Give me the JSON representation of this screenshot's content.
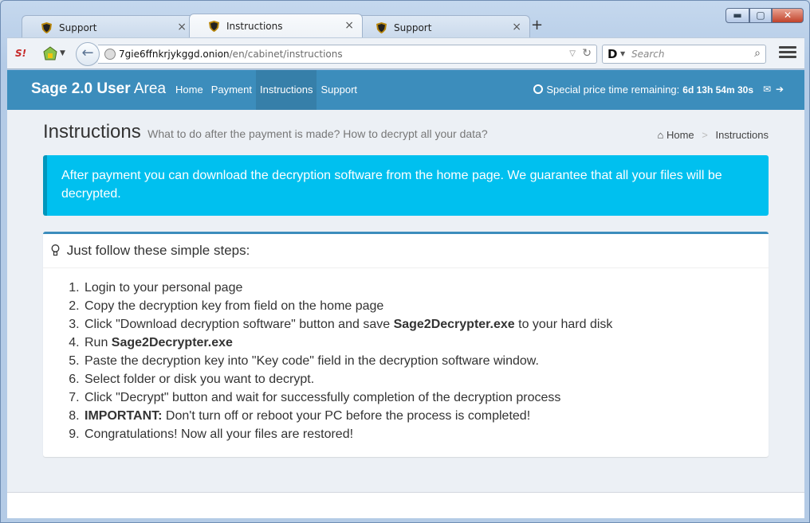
{
  "browser": {
    "tabs": [
      {
        "title": "Support",
        "active": false
      },
      {
        "title": "Instructions",
        "active": true
      },
      {
        "title": "Support",
        "active": false
      }
    ],
    "new_tab_icon": "plus-icon",
    "url_host": "7gie6ffnkrjykggd.onion",
    "url_path": "/en/cabinet/instructions",
    "search_placeholder": "Search",
    "search_engine_glyph": "D",
    "extension_label": "S!"
  },
  "site": {
    "brand_bold": "Sage 2.0 User",
    "brand_light": "Area",
    "nav": [
      {
        "label": "Home",
        "active": false
      },
      {
        "label": "Payment",
        "active": false
      },
      {
        "label": "Instructions",
        "active": true
      },
      {
        "label": "Support",
        "active": false
      }
    ],
    "timer_label": "Special price time remaining:",
    "timer_value": "6d 13h 54m 30s"
  },
  "page": {
    "title": "Instructions",
    "subtitle": "What to do after the payment is made? How to decrypt all your data?",
    "breadcrumb": {
      "home": "Home",
      "current": "Instructions"
    },
    "alert": "After payment you can download the decryption software from the home page. We guarantee that all your files will be decrypted.",
    "steps_title": "Just follow these simple steps:",
    "steps": [
      {
        "pre": "Login to your personal page",
        "bold": "",
        "post": ""
      },
      {
        "pre": "Copy the decryption key from field on the home page",
        "bold": "",
        "post": ""
      },
      {
        "pre": "Click \"Download decryption software\" button and save ",
        "bold": "Sage2Decrypter.exe",
        "post": " to your hard disk"
      },
      {
        "pre": "Run ",
        "bold": "Sage2Decrypter.exe",
        "post": ""
      },
      {
        "pre": "Paste the decryption key into \"Key code\" field in the decryption software window.",
        "bold": "",
        "post": ""
      },
      {
        "pre": "Select folder or disk you want to decrypt.",
        "bold": "",
        "post": ""
      },
      {
        "pre": "Click \"Decrypt\" button and wait for successfully completion of the decryption process",
        "bold": "",
        "post": ""
      },
      {
        "pre": "",
        "bold": "IMPORTANT:",
        "post": " Don't turn off or reboot your PC before the process is completed!"
      },
      {
        "pre": "Congratulations! Now all your files are restored!",
        "bold": "",
        "post": ""
      }
    ]
  },
  "colors": {
    "header": "#3c8dbc",
    "alert": "#00c0ef",
    "nav_active": "#367fa9"
  }
}
